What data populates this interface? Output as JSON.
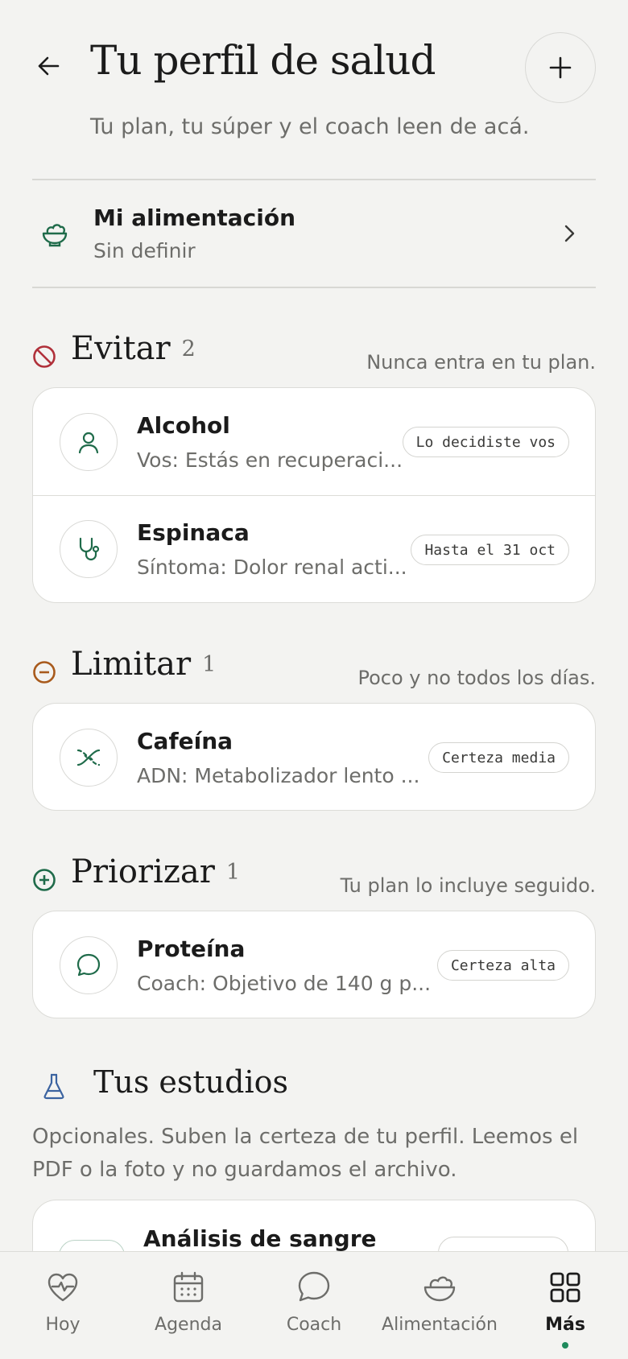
{
  "header": {
    "title": "Tu perfil de salud",
    "subtitle": "Tu plan, tu súper y el coach leen de acá."
  },
  "diet": {
    "title": "Mi alimentación",
    "value": "Sin definir"
  },
  "sections": {
    "avoid": {
      "title": "Evitar",
      "count": "2",
      "note": "Nunca entra en tu plan.",
      "items": [
        {
          "title": "Alcohol",
          "sub": "Vos: Estás en recuperaci...",
          "badge": "Lo decidiste vos",
          "icon": "user-icon"
        },
        {
          "title": "Espinaca",
          "sub": "Síntoma: Dolor renal acti...",
          "badge": "Hasta el 31 oct",
          "icon": "stethoscope-icon"
        }
      ]
    },
    "limit": {
      "title": "Limitar",
      "count": "1",
      "note": "Poco y no todos los días.",
      "items": [
        {
          "title": "Cafeína",
          "sub": "ADN: Metabolizador lento ...",
          "badge": "Certeza media",
          "icon": "dna-icon"
        }
      ]
    },
    "prioritize": {
      "title": "Priorizar",
      "count": "1",
      "note": "Tu plan lo incluye seguido.",
      "items": [
        {
          "title": "Proteína",
          "sub": "Coach: Objetivo de 140 g p...",
          "badge": "Certeza alta",
          "icon": "chat-icon"
        }
      ]
    }
  },
  "studies": {
    "title": "Tus estudios",
    "description": "Opcionales. Suben la certeza de tu perfil. Leemos el PDF o la foto y no guardamos el archivo.",
    "first_item": "Análisis de sangre"
  },
  "nav": {
    "items": [
      {
        "label": "Hoy",
        "icon": "heart-pulse-icon"
      },
      {
        "label": "Agenda",
        "icon": "calendar-icon"
      },
      {
        "label": "Coach",
        "icon": "chat-icon"
      },
      {
        "label": "Alimentación",
        "icon": "bowl-icon"
      },
      {
        "label": "Más",
        "icon": "grid-icon",
        "active": true
      }
    ]
  },
  "colors": {
    "background": "#f3f3f1",
    "accent_green": "#1f6b4a",
    "avoid_red": "#b0303a",
    "limit_orange": "#a85a1c",
    "study_blue": "#3b63a0"
  }
}
